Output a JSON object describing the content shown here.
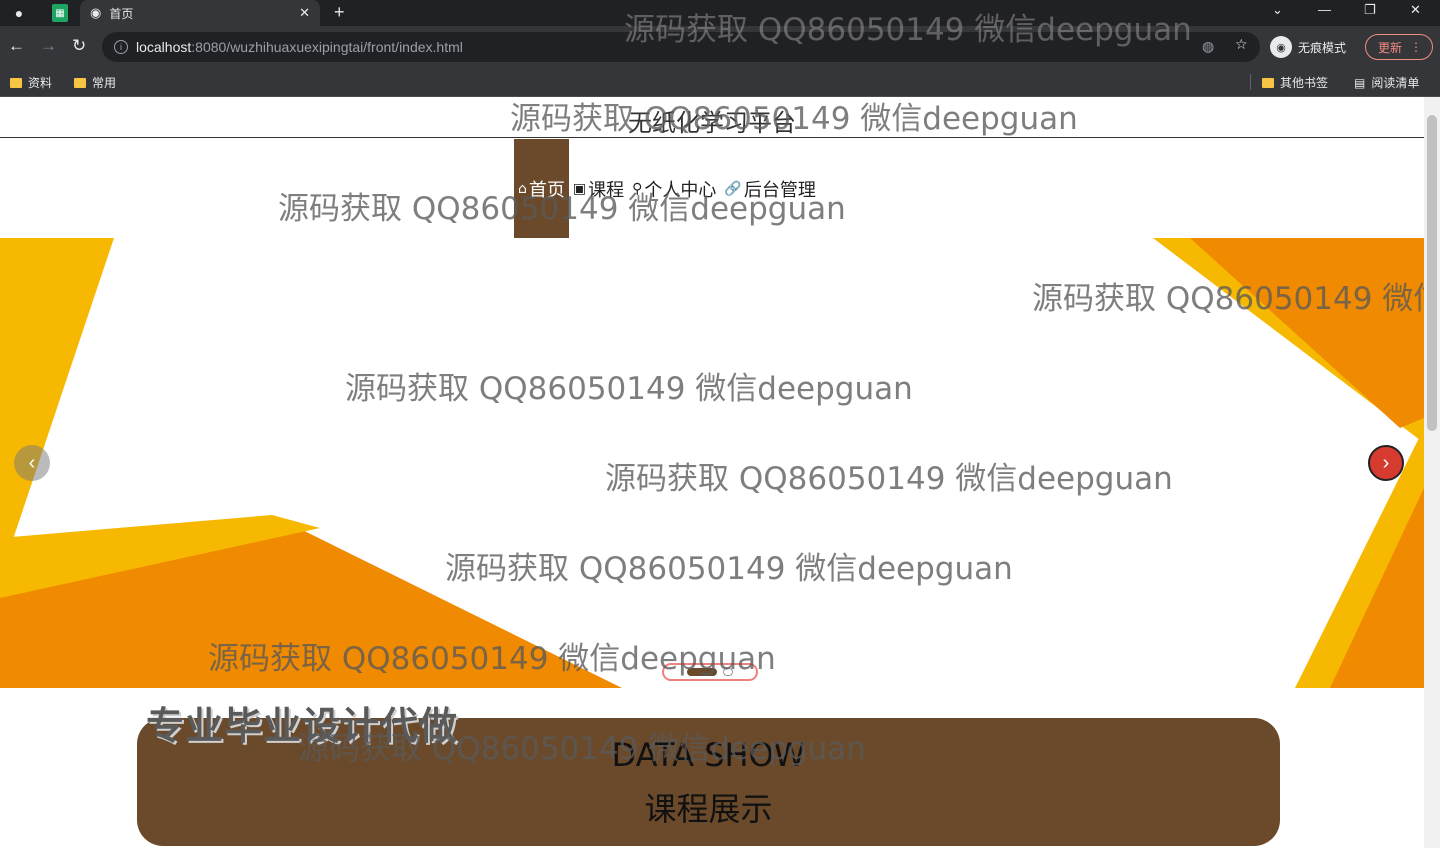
{
  "browser": {
    "tab_title": "首页",
    "url_host": "localhost",
    "url_path": ":8080/wuzhihuaxuexipingtai/front/index.html",
    "profile_label": "无痕模式",
    "update_label": "更新",
    "bookmarks": [
      "资料",
      "常用"
    ],
    "bookmarks_right": [
      "其他书签",
      "阅读清单"
    ]
  },
  "site": {
    "title": "无纸化学习平台",
    "nav": [
      {
        "label": "首页",
        "icon": "home-icon"
      },
      {
        "label": "课程",
        "icon": "book-icon"
      },
      {
        "label": "个人中心",
        "icon": "user-icon"
      },
      {
        "label": "后台管理",
        "icon": "link-icon"
      }
    ],
    "active_nav": "首页"
  },
  "banner": {
    "slide_count": 2,
    "active_slide": 1,
    "colors": {
      "orange": "#f08a00",
      "yellow": "#f6b800",
      "brown": "#6b4a2b"
    }
  },
  "promo": {
    "text": "专业毕业设计代做"
  },
  "datashow": {
    "title_en": "DATA SHOW",
    "title_cn": "课程展示"
  },
  "watermark": {
    "text": "源码获取 QQ86050149 微信deepguan"
  }
}
